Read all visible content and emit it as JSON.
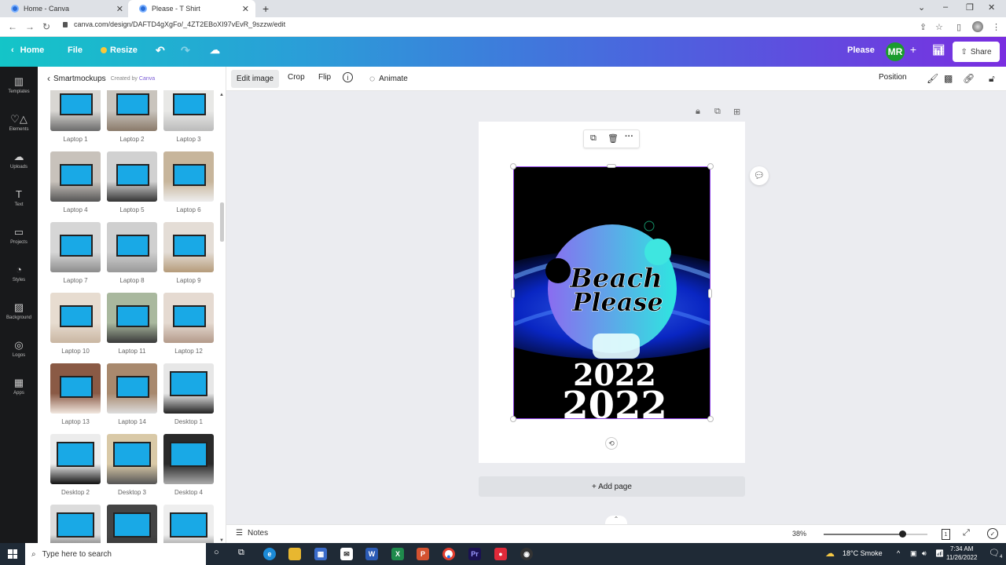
{
  "browser": {
    "tabs": [
      {
        "title": "Home - Canva",
        "active": false
      },
      {
        "title": "Please - T Shirt",
        "active": true
      }
    ],
    "url": "canva.com/design/DAFTD4gXgFo/_4ZT2EBoXI97vEvR_9szzw/edit",
    "window_controls": [
      "chevron-down",
      "minimize",
      "restore",
      "close"
    ]
  },
  "canva_header": {
    "home": "Home",
    "file": "File",
    "resize": "Resize",
    "design_name": "Please",
    "avatar_initials": "MR",
    "share": "Share",
    "brand_color": "#7a2ee0",
    "accent_start": "#14c5c8"
  },
  "rail": {
    "items": [
      {
        "label": "Templates",
        "icon": "▥"
      },
      {
        "label": "Elements",
        "icon": "♡△"
      },
      {
        "label": "Uploads",
        "icon": "☁"
      },
      {
        "label": "Text",
        "icon": "T"
      },
      {
        "label": "Projects",
        "icon": "▭"
      },
      {
        "label": "Styles",
        "icon": "◔"
      },
      {
        "label": "Background",
        "icon": "▨"
      },
      {
        "label": "Logos",
        "icon": "◎"
      },
      {
        "label": "Apps",
        "icon": "▦"
      }
    ]
  },
  "panel": {
    "title": "Smartmockups",
    "created_by": "Created by",
    "creator": "Canva",
    "mockups": [
      "Laptop 1",
      "Laptop 2",
      "Laptop 3",
      "Laptop 4",
      "Laptop 5",
      "Laptop 6",
      "Laptop 7",
      "Laptop 8",
      "Laptop 9",
      "Laptop 10",
      "Laptop 11",
      "Laptop 12",
      "Laptop 13",
      "Laptop 14",
      "Desktop 1",
      "Desktop 2",
      "Desktop 3",
      "Desktop 4",
      "",
      "",
      ""
    ]
  },
  "toolbar": {
    "edit_image": "Edit image",
    "crop": "Crop",
    "flip": "Flip",
    "animate": "Animate",
    "position": "Position"
  },
  "canvas": {
    "design_text_1": "Beach",
    "design_text_2": "Please",
    "year_1": "2022",
    "year_2": "2022",
    "add_page": "+ Add page"
  },
  "footer": {
    "notes": "Notes",
    "zoom": "38%",
    "zoom_fraction": 0.38,
    "page_number": "1"
  },
  "taskbar": {
    "search_placeholder": "Type here to search",
    "weather": "18°C  Smoke",
    "time": "7:34 AM",
    "date": "11/26/2022",
    "notifications": "4"
  }
}
